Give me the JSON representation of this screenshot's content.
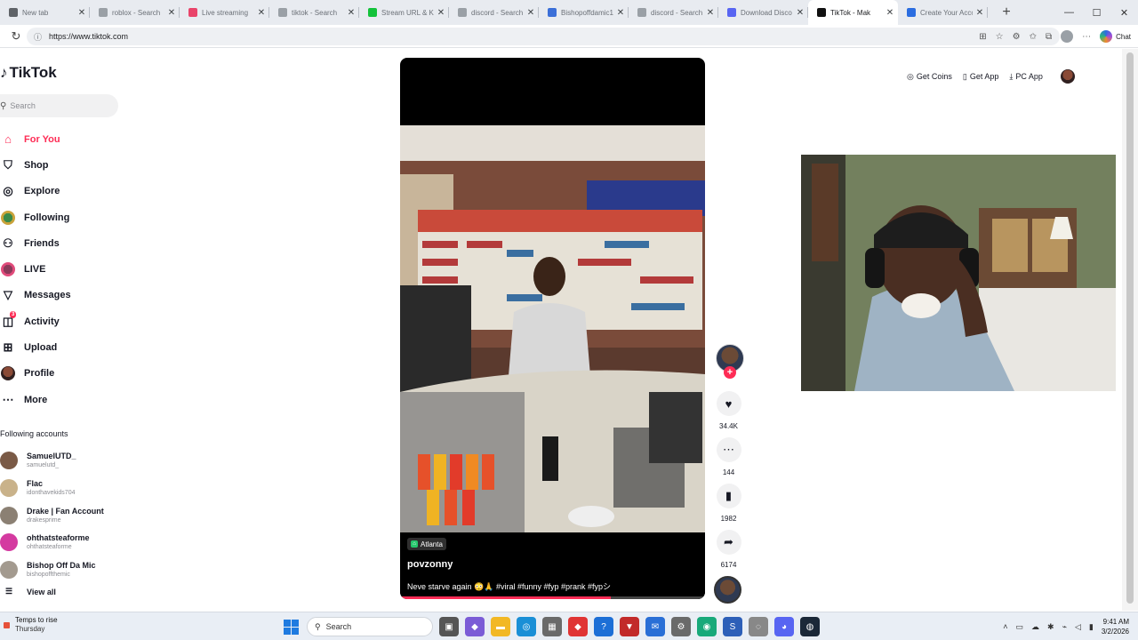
{
  "browser": {
    "tabs": [
      {
        "title": "New tab",
        "fav_color": "#5f6368"
      },
      {
        "title": "roblox - Search",
        "fav_color": "#9aa0a6"
      },
      {
        "title": "Live streaming",
        "fav_color": "#e9446a"
      },
      {
        "title": "tiktok - Search",
        "fav_color": "#9aa0a6"
      },
      {
        "title": "Stream URL & Ke",
        "fav_color": "#13c23a"
      },
      {
        "title": "discord - Search",
        "fav_color": "#9aa0a6"
      },
      {
        "title": "Bishopoffdamic1",
        "fav_color": "#3b6fd8"
      },
      {
        "title": "discord - Search",
        "fav_color": "#9aa0a6"
      },
      {
        "title": "Download Disco",
        "fav_color": "#5865f2"
      },
      {
        "title": "TikTok - Mak",
        "fav_color": "#111111",
        "active": true
      },
      {
        "title": "Create Your Accou",
        "fav_color": "#2b6de0"
      }
    ],
    "new_tab_symbol": "+",
    "url": "https://www.tiktok.com",
    "chat_label": "Chat"
  },
  "tiktok": {
    "logo": "TikTok",
    "search_placeholder": "Search",
    "nav": [
      {
        "label": "For You",
        "icon": "home-icon"
      },
      {
        "label": "Shop",
        "icon": "shop-icon"
      },
      {
        "label": "Explore",
        "icon": "compass-icon"
      },
      {
        "label": "Following",
        "icon": "following-avatar-icon"
      },
      {
        "label": "Friends",
        "icon": "friends-icon"
      },
      {
        "label": "LIVE",
        "icon": "live-icon"
      },
      {
        "label": "Messages",
        "icon": "messages-icon"
      },
      {
        "label": "Activity",
        "icon": "activity-icon",
        "badge": "3"
      },
      {
        "label": "Upload",
        "icon": "upload-icon"
      },
      {
        "label": "Profile",
        "icon": "profile-icon"
      },
      {
        "label": "More",
        "icon": "more-icon"
      }
    ],
    "following_title": "Following accounts",
    "following": [
      {
        "name": "SamuelUTD_",
        "handle": "samuelutd_",
        "color": "#7a5a46"
      },
      {
        "name": "Flac",
        "handle": "idonthavekids704",
        "color": "#c9b28a"
      },
      {
        "name": "Drake | Fan Account",
        "handle": "drakesprime",
        "color": "#8b8073"
      },
      {
        "name": "ohthatsteaforme",
        "handle": "ohthatsteaforme",
        "color": "#d43aa0"
      },
      {
        "name": "Bishop Off Da Mic",
        "handle": "bishopoffthemic",
        "color": "#a39a8f"
      }
    ],
    "view_all": "View all",
    "video": {
      "location": "Atlanta",
      "author": "povzonny",
      "caption": "Neve starve again 😳🙏 #viral #funny #fyp #prank #fypシ",
      "progress": 0.69
    },
    "actions": {
      "likes": "34.4K",
      "comments": "144",
      "saves": "1982",
      "shares": "6174"
    },
    "top": {
      "coins": "Get Coins",
      "app": "Get App",
      "pc": "PC App"
    }
  },
  "taskbar": {
    "weather_line1": "Temps to rise",
    "weather_line2": "Thursday",
    "search": "Search",
    "time": "9:41 AM",
    "date": "3/2/2026"
  }
}
